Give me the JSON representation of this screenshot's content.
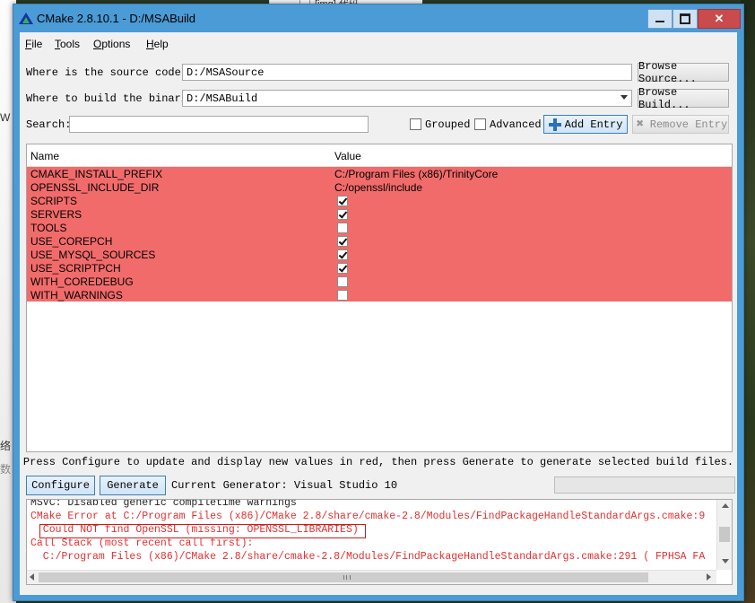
{
  "window": {
    "title": "CMake 2.8.10.1 - D:/MSABuild",
    "close_label": "✕"
  },
  "background": {
    "top_label": "[img] 代码",
    "left_fragments": [
      "W",
      "络",
      "数"
    ]
  },
  "menu": [
    {
      "label": "File",
      "u": "F",
      "rest": "ile"
    },
    {
      "label": "Tools",
      "u": "T",
      "rest": "ools"
    },
    {
      "label": "Options",
      "u": "O",
      "rest": "ptions"
    },
    {
      "label": "Help",
      "u": "H",
      "rest": "elp"
    }
  ],
  "source": {
    "label": "Where is the source code:",
    "value": "D:/MSASource",
    "browse_label": "Browse Source..."
  },
  "build": {
    "label": "Where to build the binaries:",
    "value": "D:/MSABuild",
    "browse_label": "Browse Build..."
  },
  "search": {
    "label": "Search:",
    "value": ""
  },
  "options": {
    "grouped_label": "Grouped",
    "grouped_checked": false,
    "advanced_label": "Advanced",
    "advanced_checked": false
  },
  "toolbar": {
    "add_entry_label": "Add Entry",
    "remove_entry_label": "Remove Entry"
  },
  "table": {
    "columns": [
      "Name",
      "Value"
    ],
    "row_color": "#f26b6b",
    "rows": [
      {
        "name": "CMAKE_INSTALL_PREFIX",
        "type": "text",
        "value": "C:/Program Files (x86)/TrinityCore"
      },
      {
        "name": "OPENSSL_INCLUDE_DIR",
        "type": "text",
        "value": "C:/openssl/include"
      },
      {
        "name": "SCRIPTS",
        "type": "bool",
        "checked": true
      },
      {
        "name": "SERVERS",
        "type": "bool",
        "checked": true
      },
      {
        "name": "TOOLS",
        "type": "bool",
        "checked": false
      },
      {
        "name": "USE_COREPCH",
        "type": "bool",
        "checked": true
      },
      {
        "name": "USE_MYSQL_SOURCES",
        "type": "bool",
        "checked": true
      },
      {
        "name": "USE_SCRIPTPCH",
        "type": "bool",
        "checked": true
      },
      {
        "name": "WITH_COREDEBUG",
        "type": "bool",
        "checked": false
      },
      {
        "name": "WITH_WARNINGS",
        "type": "bool",
        "checked": false
      }
    ]
  },
  "hint": "Press Configure to update and display new values in red, then press Generate to generate selected build files.",
  "actions": {
    "configure_label": "Configure",
    "generate_label": "Generate",
    "generator_text": "Current Generator: Visual Studio 10"
  },
  "log": {
    "lines": [
      {
        "text": "MSVC: Disabled generic compiletime warnings",
        "color": "black"
      },
      {
        "text": "CMake Error at C:/Program Files (x86)/CMake 2.8/share/cmake-2.8/Modules/FindPackageHandleStandardArgs.cmake:9",
        "color": "red"
      },
      {
        "text": "  Could NOT find OpenSSL (missing: OPENSSL_LIBRARIES)",
        "color": "red"
      },
      {
        "text": "Call Stack (most recent call first):",
        "color": "red"
      },
      {
        "text": "  C:/Program Files (x86)/CMake 2.8/share/cmake-2.8/Modules/FindPackageHandleStandardArgs.cmake:291 ( FPHSA FA",
        "color": "red"
      }
    ]
  }
}
